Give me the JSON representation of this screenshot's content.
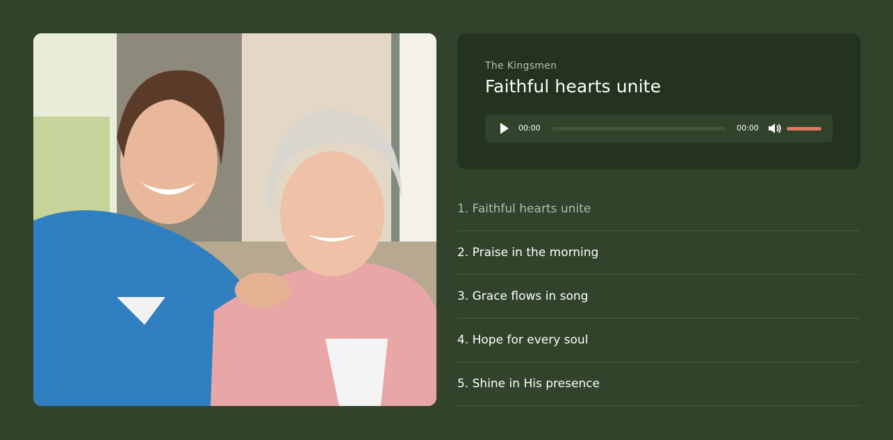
{
  "player": {
    "artist": "The Kingsmen",
    "title": "Faithful hearts unite",
    "current_time": "00:00",
    "duration": "00:00",
    "progress": 0,
    "volume": 1.0,
    "accent_color": "#e07a5f"
  },
  "photo": {
    "icon": "photo-image"
  },
  "playlist": [
    {
      "label": "1. Faithful hearts unite",
      "active": true
    },
    {
      "label": "2. Praise in the morning",
      "active": false
    },
    {
      "label": "3. Grace flows in song",
      "active": false
    },
    {
      "label": "4. Hope for every soul",
      "active": false
    },
    {
      "label": "5. Shine in His presence",
      "active": false
    }
  ],
  "colors": {
    "background": "#31432b",
    "card": "#24331f",
    "divider": "#4a5a44"
  }
}
